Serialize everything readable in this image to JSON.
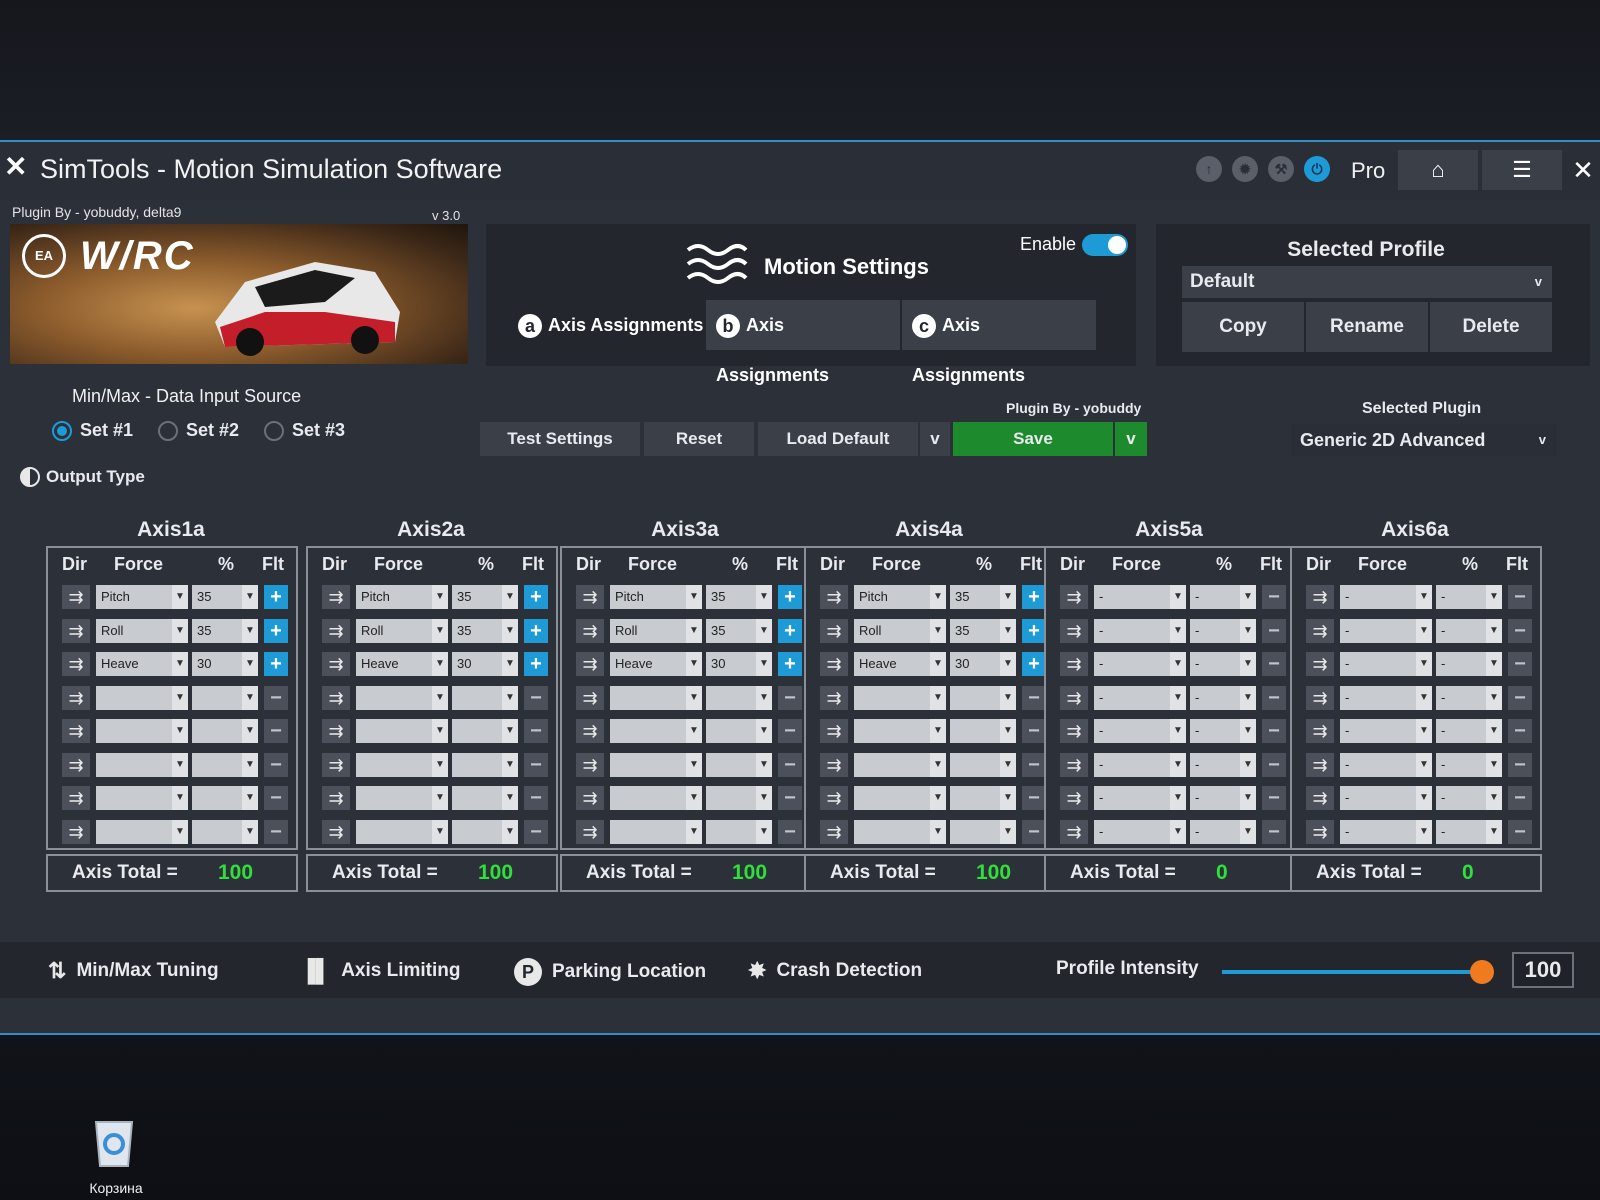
{
  "window": {
    "title": "SimTools - Motion Simulation Software",
    "edition": "Pro",
    "close": "✕"
  },
  "plugin": {
    "by": "Plugin By - yobuddy, delta9",
    "version": "v 3.0",
    "game_logo": "WRC",
    "publisher_logo": "EA SPORTS"
  },
  "motion": {
    "title": "Motion Settings",
    "enable_label": "Enable",
    "enabled": true,
    "tabs": [
      {
        "badge": "a",
        "label": "Axis Assignments"
      },
      {
        "badge": "b",
        "label": "Axis Assignments"
      },
      {
        "badge": "c",
        "label": "Axis Assignments"
      }
    ]
  },
  "profile": {
    "title": "Selected Profile",
    "value": "Default",
    "buttons": [
      "Copy",
      "Rename",
      "Delete"
    ]
  },
  "minmax": {
    "title": "Min/Max - Data Input Source",
    "options": [
      "Set #1",
      "Set #2",
      "Set #3"
    ],
    "selected": "Set #1"
  },
  "output_type": "Output Type",
  "actions": {
    "test": "Test Settings",
    "reset": "Reset",
    "load_default": "Load Default",
    "save": "Save",
    "dropdown": "v"
  },
  "selected_plugin": {
    "by": "Plugin By - yobuddy",
    "title": "Selected Plugin",
    "value": "Generic 2D Advanced"
  },
  "axis_headers": {
    "dir": "Dir",
    "force": "Force",
    "pct": "%",
    "flt": "Flt"
  },
  "axis_total_label": "Axis Total =",
  "axes": [
    {
      "name": "Axis1a",
      "total": "100",
      "rows": [
        [
          "Pitch",
          "35"
        ],
        [
          "Roll",
          "35"
        ],
        [
          "Heave",
          "30"
        ],
        [
          "",
          ""
        ],
        [
          "",
          ""
        ],
        [
          "",
          ""
        ],
        [
          "",
          ""
        ],
        [
          "",
          ""
        ]
      ]
    },
    {
      "name": "Axis2a",
      "total": "100",
      "rows": [
        [
          "Pitch",
          "35"
        ],
        [
          "Roll",
          "35"
        ],
        [
          "Heave",
          "30"
        ],
        [
          "",
          ""
        ],
        [
          "",
          ""
        ],
        [
          "",
          ""
        ],
        [
          "",
          ""
        ],
        [
          "",
          ""
        ]
      ]
    },
    {
      "name": "Axis3a",
      "total": "100",
      "rows": [
        [
          "Pitch",
          "35"
        ],
        [
          "Roll",
          "35"
        ],
        [
          "Heave",
          "30"
        ],
        [
          "",
          ""
        ],
        [
          "",
          ""
        ],
        [
          "",
          ""
        ],
        [
          "",
          ""
        ],
        [
          "",
          ""
        ]
      ]
    },
    {
      "name": "Axis4a",
      "total": "100",
      "rows": [
        [
          "Pitch",
          "35"
        ],
        [
          "Roll",
          "35"
        ],
        [
          "Heave",
          "30"
        ],
        [
          "",
          ""
        ],
        [
          "",
          ""
        ],
        [
          "",
          ""
        ],
        [
          "",
          ""
        ],
        [
          "",
          ""
        ]
      ]
    },
    {
      "name": "Axis5a",
      "total": "0",
      "rows": [
        [
          "-",
          "-"
        ],
        [
          "-",
          "-"
        ],
        [
          "-",
          "-"
        ],
        [
          "-",
          "-"
        ],
        [
          "-",
          "-"
        ],
        [
          "-",
          "-"
        ],
        [
          "-",
          "-"
        ],
        [
          "-",
          "-"
        ]
      ]
    },
    {
      "name": "Axis6a",
      "total": "0",
      "rows": [
        [
          "-",
          "-"
        ],
        [
          "-",
          "-"
        ],
        [
          "-",
          "-"
        ],
        [
          "-",
          "-"
        ],
        [
          "-",
          "-"
        ],
        [
          "-",
          "-"
        ],
        [
          "-",
          "-"
        ],
        [
          "-",
          "-"
        ]
      ]
    }
  ],
  "bottom": {
    "minmax_tuning": "Min/Max Tuning",
    "axis_limiting": "Axis Limiting",
    "parking_location": "Parking Location",
    "crash_detection": "Crash Detection",
    "intensity_label": "Profile Intensity",
    "intensity_value": "100",
    "intensity_fraction": 1.0
  },
  "desktop": {
    "recycle_bin": "Корзина"
  },
  "colors": {
    "accent": "#1e9bd7",
    "save_green": "#1e8a2e",
    "total_green": "#2fe03a",
    "slider_knob": "#f07a1e"
  }
}
